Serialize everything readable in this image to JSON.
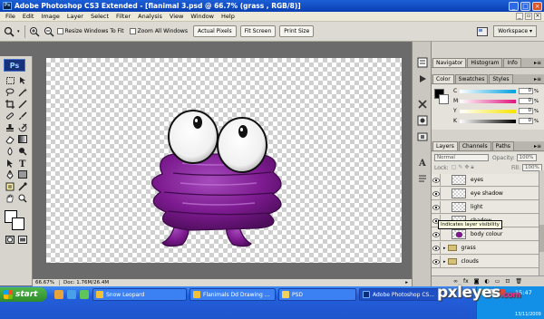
{
  "window": {
    "title": "Adobe Photoshop CS3 Extended - [flanimal 3.psd @ 66.7% (grass , RGB/8)]",
    "app_icon": "Ps"
  },
  "menu": [
    "File",
    "Edit",
    "Image",
    "Layer",
    "Select",
    "Filter",
    "Analysis",
    "View",
    "Window",
    "Help"
  ],
  "options_bar": {
    "resize_windows_label": "Resize Windows To Fit",
    "zoom_all_windows_label": "Zoom All Windows",
    "actual_pixels": "Actual Pixels",
    "fit_screen": "Fit Screen",
    "print_size": "Print Size",
    "workspace": "Workspace"
  },
  "tools": {
    "logo": "Ps",
    "icons": [
      "marquee-icon",
      "move-icon",
      "lasso-icon",
      "magic-wand-icon",
      "crop-icon",
      "slice-icon",
      "healing-icon",
      "brush-icon",
      "clone-stamp-icon",
      "history-brush-icon",
      "eraser-icon",
      "gradient-icon",
      "blur-icon",
      "dodge-icon",
      "pen-icon",
      "type-icon",
      "path-select-icon",
      "shape-icon",
      "notes-icon",
      "eyedropper-icon",
      "hand-icon",
      "zoom-icon"
    ]
  },
  "status_bar": {
    "zoom": "66.67%",
    "doc_size": "Doc: 1.76M/26.4M"
  },
  "panels": {
    "navigator_tabs": [
      "Navigator",
      "Histogram",
      "Info"
    ],
    "color_tabs": [
      "Color",
      "Swatches",
      "Styles"
    ],
    "color_channels": [
      {
        "label": "C",
        "value": "0",
        "color": "#00a0e0"
      },
      {
        "label": "M",
        "value": "0",
        "color": "#e0157f"
      },
      {
        "label": "Y",
        "value": "0",
        "color": "#f5e400"
      },
      {
        "label": "K",
        "value": "0",
        "color": "#000000"
      }
    ],
    "layers_tabs": [
      "Layers",
      "Channels",
      "Paths"
    ],
    "blend_mode": "Normal",
    "opacity_label": "Opacity:",
    "opacity_value": "100%",
    "lock_label": "Lock:",
    "fill_label": "Fill:",
    "fill_value": "100%",
    "layers": [
      {
        "name": "eyes",
        "visible": true,
        "type": "layer"
      },
      {
        "name": "eye shadow",
        "visible": true,
        "type": "layer"
      },
      {
        "name": "light",
        "visible": true,
        "type": "layer"
      },
      {
        "name": "shadow",
        "visible": true,
        "type": "layer"
      },
      {
        "name": "body colour",
        "visible": true,
        "type": "layer",
        "thumb_color": "#7a1a8c"
      },
      {
        "name": "grass",
        "visible": true,
        "type": "group"
      },
      {
        "name": "clouds",
        "visible": true,
        "type": "group"
      }
    ],
    "tooltip": "Indicates layer visibility"
  },
  "taskbar": {
    "start": "start",
    "tasks": [
      {
        "label": "Snow Leopard",
        "icon_color": "#f2c13a",
        "active": false
      },
      {
        "label": "Flanimals Dd Drawing ...",
        "icon_color": "#f2c13a",
        "active": false
      },
      {
        "label": "PSD",
        "icon_color": "#f2d25a",
        "active": false
      },
      {
        "label": "Adobe Photoshop CS...",
        "icon_color": "#0c2e7a",
        "active": true
      }
    ],
    "time": "15:47",
    "date": "13/11/2009"
  },
  "watermark": {
    "text": "pxleyes",
    "suffix": ".com"
  },
  "colors": {
    "creature_purple": "#7b1a8e",
    "creature_highlight": "#b35ac8",
    "xp_blue": "#245edb",
    "start_green": "#3aa136"
  }
}
